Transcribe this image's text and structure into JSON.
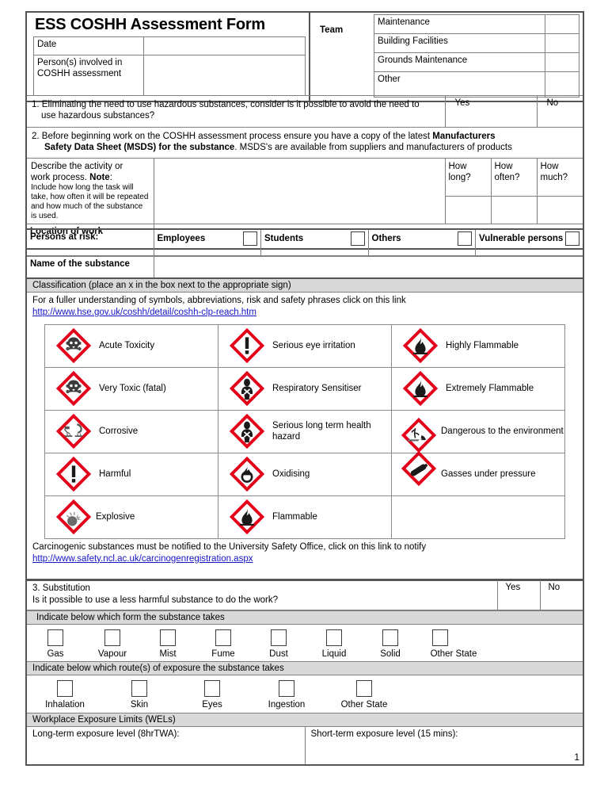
{
  "document": {
    "title": "ESS COSHH Assessment Form",
    "page_number": "1"
  },
  "header": {
    "date_label": "Date",
    "date_value": "",
    "persons_label": "Person(s) involved in COSHH assessment",
    "persons_value": "",
    "team_label": "Team",
    "teams": [
      {
        "name": "Maintenance",
        "checked": ""
      },
      {
        "name": "Building Facilities",
        "checked": ""
      },
      {
        "name": "Grounds Maintenance",
        "checked": ""
      },
      {
        "name": "Other",
        "checked": ""
      }
    ]
  },
  "questions": {
    "q1_line1": "1. Eliminating the need to use hazardous substances, consider is it possible to avoid the need to",
    "q1_line2": "use hazardous substances?",
    "q1_yes": "Yes",
    "q1_no": "No",
    "q2_line1_a": "2. Before beginning work on the COSHH assessment process ensure you have a copy of the latest ",
    "q2_line1_b": "Manufacturers",
    "q2_line2_a": "Safety Data Sheet (MSDS) for the substance",
    "q2_line2_b": ". MSDS's are available from suppliers and manufacturers of products"
  },
  "activity": {
    "describe_line1": "Describe the activity or",
    "describe_line2_a": "work process.  ",
    "describe_line2_b": "Note",
    "describe_line2_c": ":",
    "describe_small": "Include how long the task will take, how often it will be repeated and how much of the substance is used.",
    "describe_value": "",
    "how_long": "How long?",
    "how_often": "How often?",
    "how_much": "How much?",
    "how_long_value": "",
    "how_often_value": "",
    "how_much_value": "",
    "location_label": "Location of work",
    "location_value": ""
  },
  "risk": {
    "label": "Persons at risk:",
    "options": [
      {
        "name": "Employees",
        "checked": ""
      },
      {
        "name": "Students",
        "checked": ""
      },
      {
        "name": "Others",
        "checked": ""
      },
      {
        "name": "Vulnerable persons",
        "checked": ""
      }
    ],
    "substance_label": "Name of the substance",
    "substance_value": ""
  },
  "classification": {
    "heading": "Classification (place an x in the box next to the appropriate sign)",
    "intro": "For a fuller understanding of symbols, abbreviations, risk and safety phrases click on this link",
    "link": "http://www.hse.gov.uk/coshh/detail/coshh-clp-reach.htm",
    "hazards": [
      {
        "label": "Acute Toxicity",
        "icon": "skull-crossbones-pictogram"
      },
      {
        "label": "Serious eye irritation",
        "icon": "exclamation-mark-pictogram"
      },
      {
        "label": "Highly Flammable",
        "icon": "flame-pictogram"
      },
      {
        "label": "Very Toxic (fatal)",
        "icon": "skull-crossbones-pictogram"
      },
      {
        "label": "Respiratory Sensitiser",
        "icon": "health-hazard-pictogram"
      },
      {
        "label": "Extremely Flammable",
        "icon": "flame-pictogram"
      },
      {
        "label": "Corrosive",
        "icon": "corrosion-pictogram"
      },
      {
        "label": "Serious long term health hazard",
        "icon": "health-hazard-pictogram"
      },
      {
        "label": "Dangerous to the environment",
        "icon": "environment-pictogram"
      },
      {
        "label": "Harmful",
        "icon": "exclamation-mark-pictogram"
      },
      {
        "label": "Oxidising",
        "icon": "flame-over-circle-pictogram"
      },
      {
        "label": "Gasses under pressure",
        "icon": "gas-cylinder-pictogram"
      },
      {
        "label": "Explosive",
        "icon": "exploding-bomb-pictogram"
      },
      {
        "label": "Flammable",
        "icon": "flame-pictogram"
      },
      {
        "label": "",
        "icon": ""
      }
    ],
    "carcinogen_note": "Carcinogenic substances must be notified to the University Safety Office, click on this link to notify",
    "carcinogen_link": "http://www.safety.ncl.ac.uk/carcinogenregistration.aspx"
  },
  "substitution": {
    "heading_line1": "3. Substitution",
    "heading_line2": "Is it possible to use a less harmful substance to do the work?",
    "yes": "Yes",
    "no": "No",
    "form_heading": "Indicate below which form the substance takes",
    "forms": [
      {
        "name": "Gas",
        "checked": ""
      },
      {
        "name": "Vapour",
        "checked": ""
      },
      {
        "name": "Mist",
        "checked": ""
      },
      {
        "name": "Fume",
        "checked": ""
      },
      {
        "name": "Dust",
        "checked": ""
      },
      {
        "name": "Liquid",
        "checked": ""
      },
      {
        "name": "Solid",
        "checked": ""
      },
      {
        "name": "Other  State",
        "checked": ""
      }
    ],
    "route_heading": "Indicate below which route(s) of exposure the substance takes",
    "routes": [
      {
        "name": "Inhalation",
        "checked": ""
      },
      {
        "name": "Skin",
        "checked": ""
      },
      {
        "name": "Eyes",
        "checked": ""
      },
      {
        "name": "Ingestion",
        "checked": ""
      },
      {
        "name": "Other State",
        "checked": ""
      }
    ],
    "wel_heading": "Workplace Exposure Limits (WELs)",
    "wel_long": "Long-term exposure level (8hrTWA):",
    "wel_long_value": "",
    "wel_short": "Short-term exposure level (15 mins):",
    "wel_short_value": ""
  },
  "colors": {
    "shade": "#d9d9d9",
    "link": "#1414c8",
    "pictogram_red": "#e2001a",
    "border": "#808080"
  }
}
